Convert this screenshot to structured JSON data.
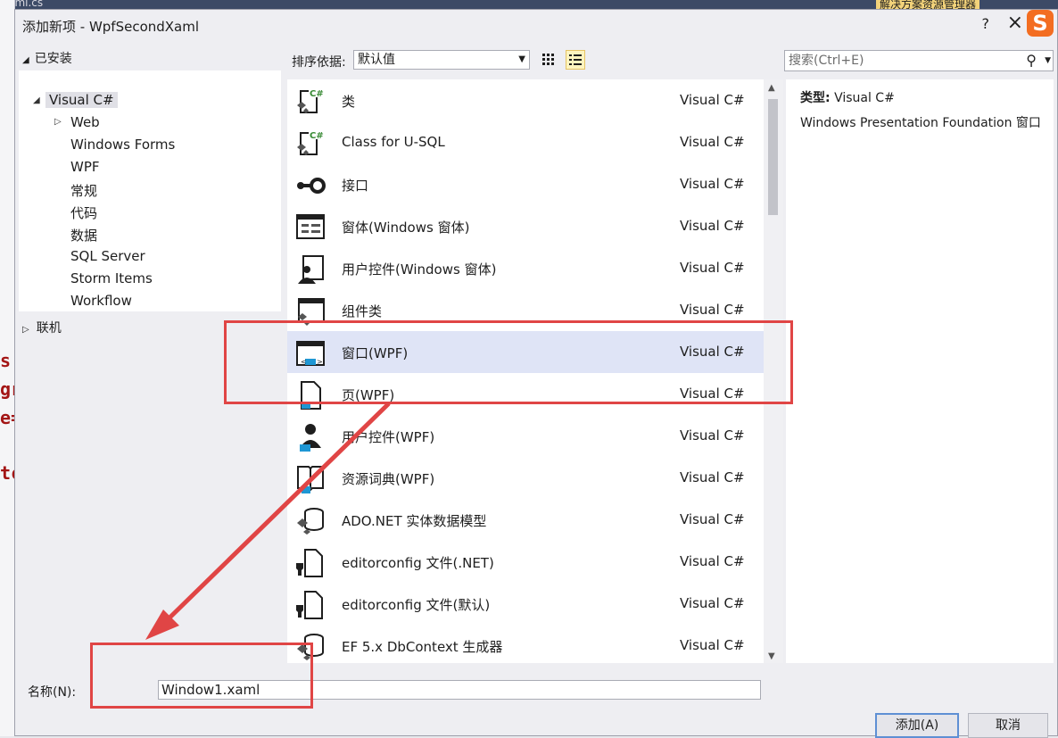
{
  "background": {
    "tab_text": "xaml.cs",
    "right_text": "解决方案资源管理器",
    "code_chars": [
      "s",
      "gr",
      "e=",
      "tc"
    ]
  },
  "dialog": {
    "title": "添加新项 - WpfSecondXaml",
    "help": "?",
    "close": "×",
    "ime_badge": "S"
  },
  "tree": {
    "installed_label": "已安装",
    "root": "Visual C#",
    "items": [
      "Web",
      "Windows Forms",
      "WPF",
      "常规",
      "代码",
      "数据",
      "SQL Server",
      "Storm Items",
      "Workflow"
    ],
    "online_label": "联机"
  },
  "toolbar": {
    "sort_label": "排序依据:",
    "sort_value": "默认值",
    "search_placeholder": "搜索(Ctrl+E)"
  },
  "templates": [
    {
      "name": "类",
      "lang": "Visual C#",
      "icon": "class-icon"
    },
    {
      "name": "Class for U-SQL",
      "lang": "Visual C#",
      "icon": "class-icon"
    },
    {
      "name": "接口",
      "lang": "Visual C#",
      "icon": "interface-icon"
    },
    {
      "name": "窗体(Windows 窗体)",
      "lang": "Visual C#",
      "icon": "form-icon"
    },
    {
      "name": "用户控件(Windows 窗体)",
      "lang": "Visual C#",
      "icon": "user-control-icon"
    },
    {
      "name": "组件类",
      "lang": "Visual C#",
      "icon": "component-icon"
    },
    {
      "name": "窗口(WPF)",
      "lang": "Visual C#",
      "icon": "wpf-window-icon",
      "selected": true
    },
    {
      "name": "页(WPF)",
      "lang": "Visual C#",
      "icon": "wpf-page-icon"
    },
    {
      "name": "用户控件(WPF)",
      "lang": "Visual C#",
      "icon": "wpf-user-control-icon"
    },
    {
      "name": "资源词典(WPF)",
      "lang": "Visual C#",
      "icon": "resource-dictionary-icon"
    },
    {
      "name": "ADO.NET 实体数据模型",
      "lang": "Visual C#",
      "icon": "data-model-icon"
    },
    {
      "name": "editorconfig 文件(.NET)",
      "lang": "Visual C#",
      "icon": "config-file-icon"
    },
    {
      "name": "editorconfig 文件(默认)",
      "lang": "Visual C#",
      "icon": "config-file-icon"
    },
    {
      "name": "EF 5.x DbContext 生成器",
      "lang": "Visual C#",
      "icon": "data-model-icon"
    }
  ],
  "details": {
    "type_label": "类型:",
    "type_value": "Visual C#",
    "description": "Windows Presentation Foundation 窗口"
  },
  "bottom": {
    "name_label": "名称(N):",
    "name_value": "Window1.xaml",
    "add_button": "添加(A)",
    "cancel_button": "取消"
  },
  "colors": {
    "annotation_red": "#e04545",
    "selection": "#dfe4f6",
    "accent_blue": "#1f97d4"
  }
}
